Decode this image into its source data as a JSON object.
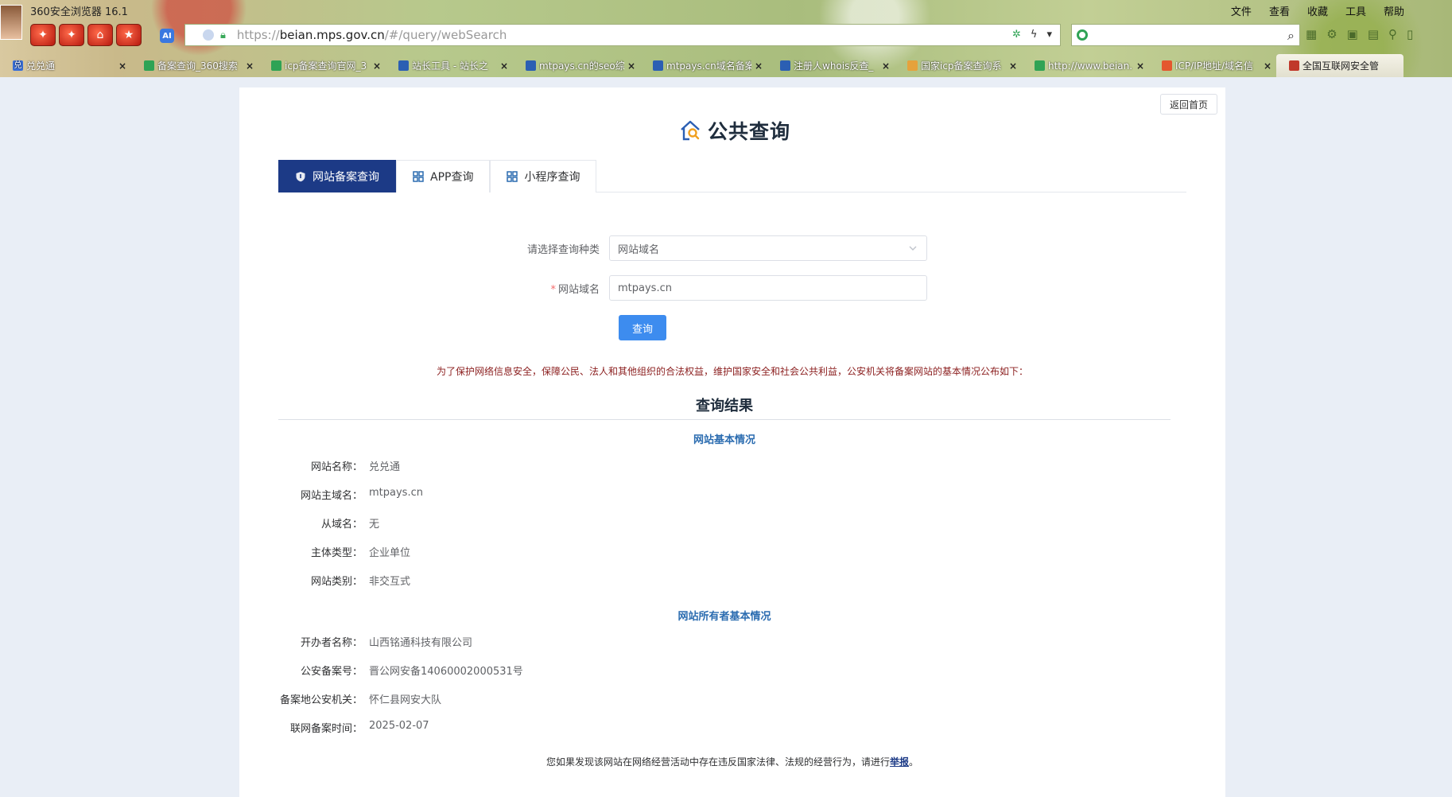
{
  "browser": {
    "title": "360安全浏览器 16.1",
    "menu": [
      "文件",
      "查看",
      "收藏",
      "工具",
      "帮助"
    ],
    "ai_label": "AI",
    "address_scheme": "https://",
    "address_host": "beian.mps.gov.cn",
    "address_path": "/#/query/webSearch",
    "search_placeholder": "",
    "tabs": [
      {
        "label": "兑兑通",
        "favicon_color": "#3a6fd8"
      },
      {
        "label": "备案查询_360搜索",
        "favicon_color": "#2fa355"
      },
      {
        "label": "icp备案查询官网_3",
        "favicon_color": "#2fa355"
      },
      {
        "label": "站长工具 - 站长之",
        "favicon_color": "#2b5fb3"
      },
      {
        "label": "mtpays.cn的seo综",
        "favicon_color": "#2b5fb3"
      },
      {
        "label": "mtpays.cn域名备案",
        "favicon_color": "#2b5fb3"
      },
      {
        "label": "注册人whois反查_",
        "favicon_color": "#2b5fb3"
      },
      {
        "label": "国家icp备案查询系",
        "favicon_color": "#e6a23c"
      },
      {
        "label": "http://www.beian.",
        "favicon_color": "#2fa355"
      },
      {
        "label": "ICP/IP地址/域名信",
        "favicon_color": "#e4572e"
      },
      {
        "label": "全国互联网安全管",
        "favicon_color": "#c0392b"
      }
    ]
  },
  "page": {
    "back_home": "返回首页",
    "title": "公共查询",
    "tabs": [
      {
        "label": "网站备案查询"
      },
      {
        "label": "APP查询"
      },
      {
        "label": "小程序查询"
      }
    ],
    "form": {
      "type_label": "请选择查询种类",
      "type_value": "网站域名",
      "domain_required_mark": "*",
      "domain_label": "网站域名",
      "domain_value": "mtpays.cn",
      "query_button": "查询"
    },
    "notice": "为了保护网络信息安全，保障公民、法人和其他组织的合法权益，维护国家安全和社会公共利益，公安机关将备案网站的基本情况公布如下：",
    "result_title": "查询结果",
    "site_section": "网站基本情况",
    "site_info": [
      {
        "key": "网站名称：",
        "value": "兑兑通"
      },
      {
        "key": "网站主域名：",
        "value": "mtpays.cn"
      },
      {
        "key": "从域名：",
        "value": "无"
      },
      {
        "key": "主体类型：",
        "value": "企业单位"
      },
      {
        "key": "网站类别：",
        "value": "非交互式"
      }
    ],
    "owner_section": "网站所有者基本情况",
    "owner_info": [
      {
        "key": "开办者名称：",
        "value": "山西铭通科技有限公司"
      },
      {
        "key": "公安备案号：",
        "value": "晋公网安备14060002000531号"
      },
      {
        "key": "备案地公安机关：",
        "value": "怀仁县网安大队"
      },
      {
        "key": "联网备案时间：",
        "value": "2025-02-07"
      }
    ],
    "footer_text": "您如果发现该网站在网络经营活动中存在违反国家法律、法规的经营行为，请进行",
    "footer_link": "举报",
    "footer_end": "。"
  },
  "colors": {
    "accent_dark": "#1c3a86",
    "button_blue": "#3d8cef",
    "notice_red": "#8b1e1e",
    "section_blue": "#2b6cb0"
  }
}
